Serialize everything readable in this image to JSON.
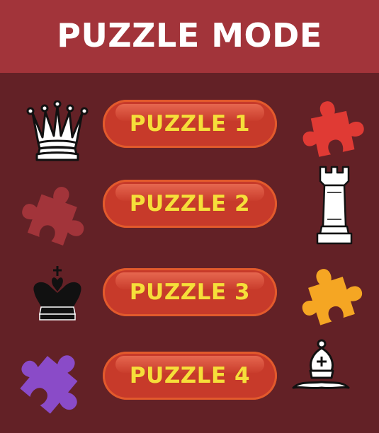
{
  "header": {
    "title": "PUZZLE MODE"
  },
  "buttons": [
    {
      "label": "PUZZLE 1"
    },
    {
      "label": "PUZZLE 2"
    },
    {
      "label": "PUZZLE 3"
    },
    {
      "label": "PUZZLE 4"
    }
  ],
  "icons": {
    "chess_pieces": [
      "queen-icon",
      "rook-icon",
      "king-icon",
      "bishop-icon"
    ],
    "jigsaw_pieces": [
      "red-puzzle-piece-icon",
      "dark-red-puzzle-piece-icon",
      "orange-puzzle-piece-icon",
      "purple-puzzle-piece-icon"
    ]
  },
  "colors": {
    "background": "#632126",
    "header": "#a2343a",
    "button": "#c73a2a",
    "button_text": "#f6de3a",
    "puzzle_red": "#e03a34",
    "puzzle_dark_red": "#a2343a",
    "puzzle_orange": "#f5a623",
    "puzzle_purple": "#8a4bc8"
  }
}
